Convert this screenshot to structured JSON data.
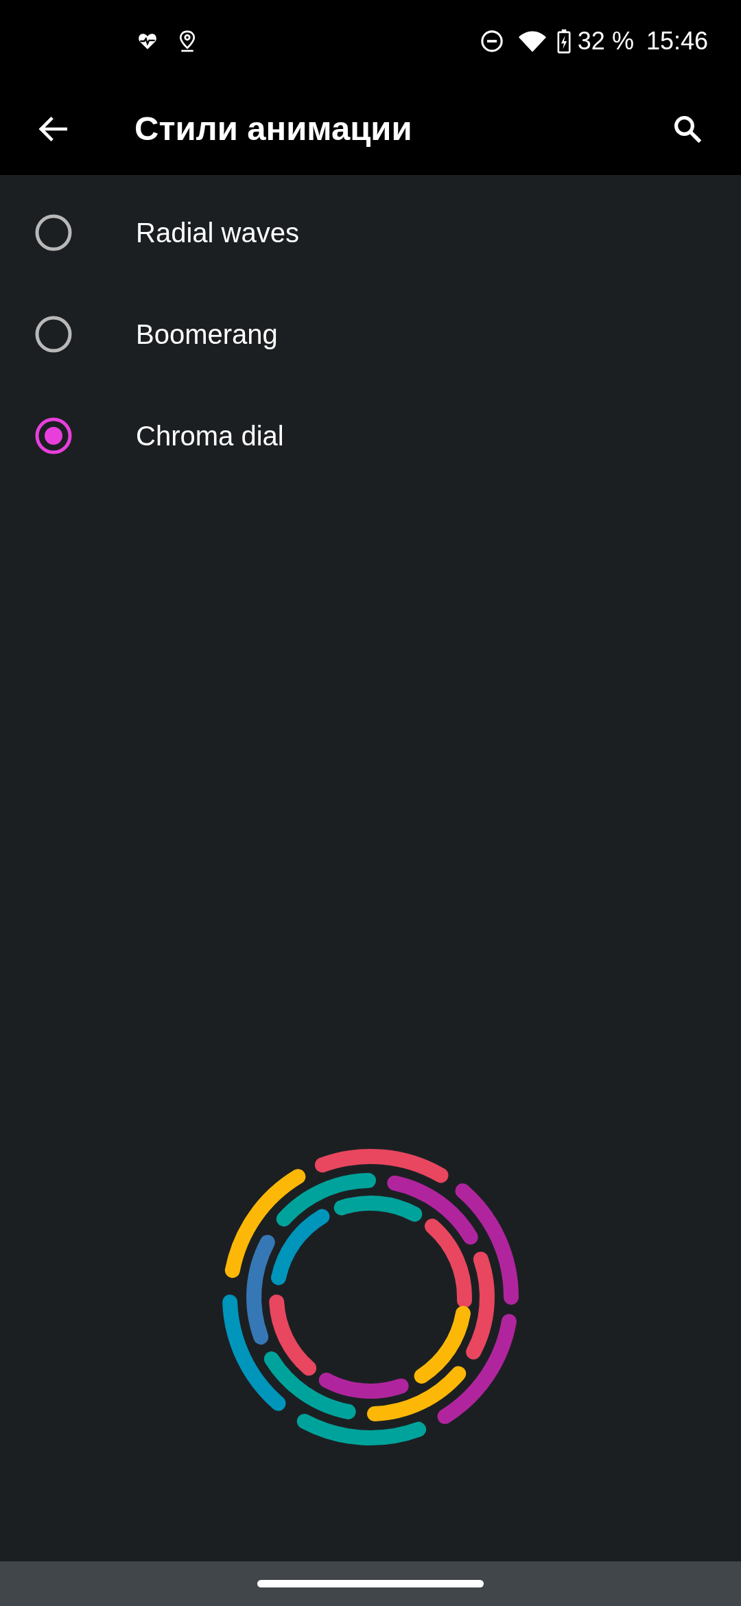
{
  "status_bar": {
    "battery": "32 %",
    "time": "15:46"
  },
  "header": {
    "title": "Стили анимации"
  },
  "options": [
    {
      "label": "Radial waves",
      "selected": false
    },
    {
      "label": "Boomerang",
      "selected": false
    },
    {
      "label": "Chroma dial",
      "selected": true
    }
  ]
}
